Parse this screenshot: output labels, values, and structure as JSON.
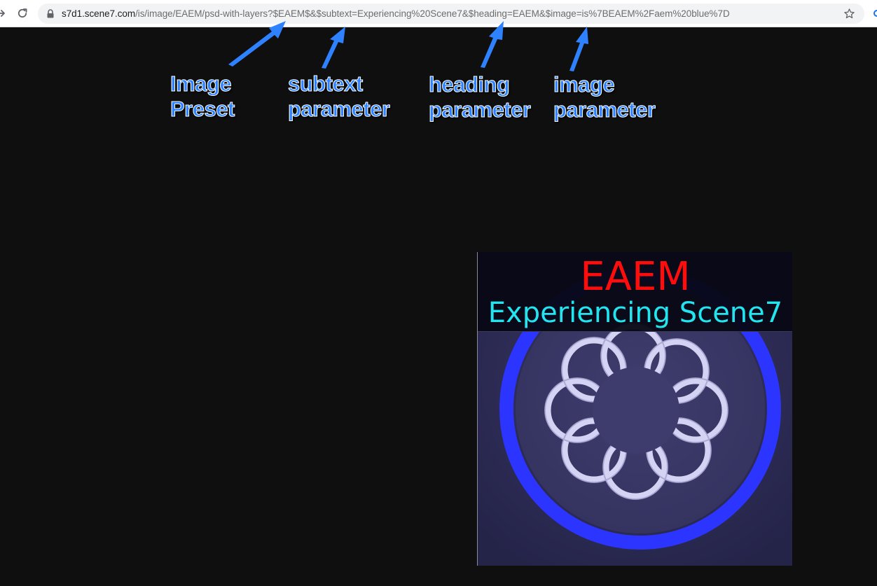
{
  "browser": {
    "url_host": "s7d1.scene7.com",
    "url_path": "/is/image/EAEM/psd-with-layers?$EAEM$&$subtext=Experiencing%20Scene7&$heading=EAEM&$image=is%7BEAEM%2Faem%20blue%7D",
    "icons": {
      "forward": "forward-arrow-icon",
      "reload": "reload-icon",
      "lock": "lock-icon",
      "bookmark": "star-icon"
    }
  },
  "annotations": [
    {
      "line1": "Image",
      "line2": "Preset"
    },
    {
      "line1": "subtext",
      "line2": "parameter"
    },
    {
      "line1": "heading",
      "line2": "parameter"
    },
    {
      "line1": "image",
      "line2": "parameter"
    }
  ],
  "rendered_image": {
    "heading": "EAEM",
    "subtext": "Experiencing Scene7",
    "logo": "aem-logo-icon"
  },
  "colors": {
    "background": "#0f0f0f",
    "annotation": "#2f82ff",
    "heading": "#ff0d0d",
    "subtext": "#22e5f0",
    "ring": "#2c35ff",
    "logo_loop": "#d5d3f4"
  }
}
